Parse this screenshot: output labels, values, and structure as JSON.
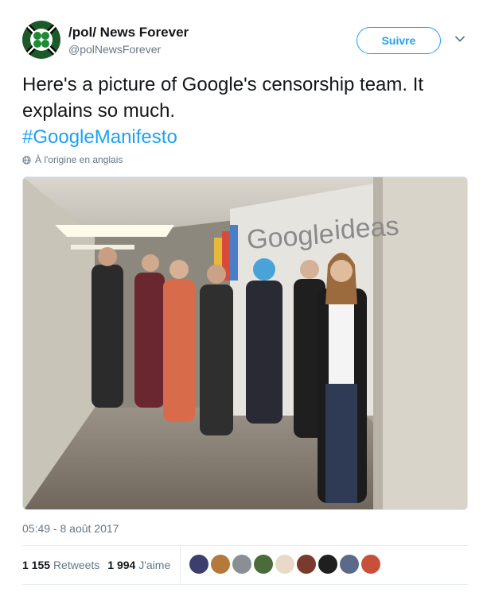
{
  "account": {
    "name": "/pol/ News Forever",
    "handle": "@polNewsForever",
    "follow_label": "Suivre"
  },
  "tweet": {
    "text": "Here's a picture of Google's censorship team. It explains so much.",
    "hashtag": "#GoogleManifesto",
    "translation_note": "À l'origine en anglais",
    "timestamp": "05:49 - 8 août 2017"
  },
  "photo": {
    "wall_sign": "Google ideas"
  },
  "stats": {
    "retweets_count": "1 155",
    "retweets_label": "Retweets",
    "likes_count": "1 994",
    "likes_label": "J'aime"
  },
  "likers": [
    {
      "color": "#3a3f6b"
    },
    {
      "color": "#b57a3a"
    },
    {
      "color": "#8a8f96"
    },
    {
      "color": "#4b6b3a"
    },
    {
      "color": "#e9d9c8"
    },
    {
      "color": "#7a3b2e"
    },
    {
      "color": "#1f1f1f"
    },
    {
      "color": "#5a6b8a"
    },
    {
      "color": "#c7503a"
    }
  ],
  "icons": {
    "globe": "globe-icon",
    "caret": "chevron-down-icon"
  }
}
